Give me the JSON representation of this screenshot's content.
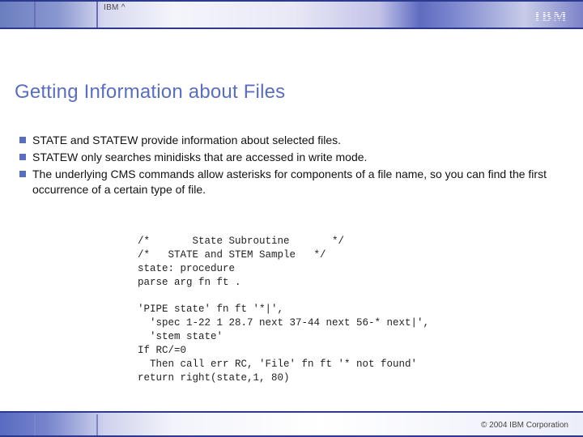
{
  "header": {
    "product_text": "IBM ^",
    "logo_text": "IBM"
  },
  "title": "Getting Information about Files",
  "bullets": [
    "STATE and STATEW provide information about selected files.",
    "STATEW only searches minidisks that are accessed in write mode.",
    "The underlying CMS commands allow asterisks for components of a file name, so you can find the first occurrence of a certain type of file."
  ],
  "code": "/*       State Subroutine       */\n/*   STATE and STEM Sample   */\nstate: procedure\nparse arg fn ft .\n\n'PIPE state' fn ft '*|',\n  'spec 1-22 1 28.7 next 37-44 next 56-* next|',\n  'stem state'\nIf RC/=0\n  Then call err RC, 'File' fn ft '* not found'\nreturn right(state,1, 80)",
  "footer": {
    "copyright": "© 2004 IBM Corporation"
  }
}
